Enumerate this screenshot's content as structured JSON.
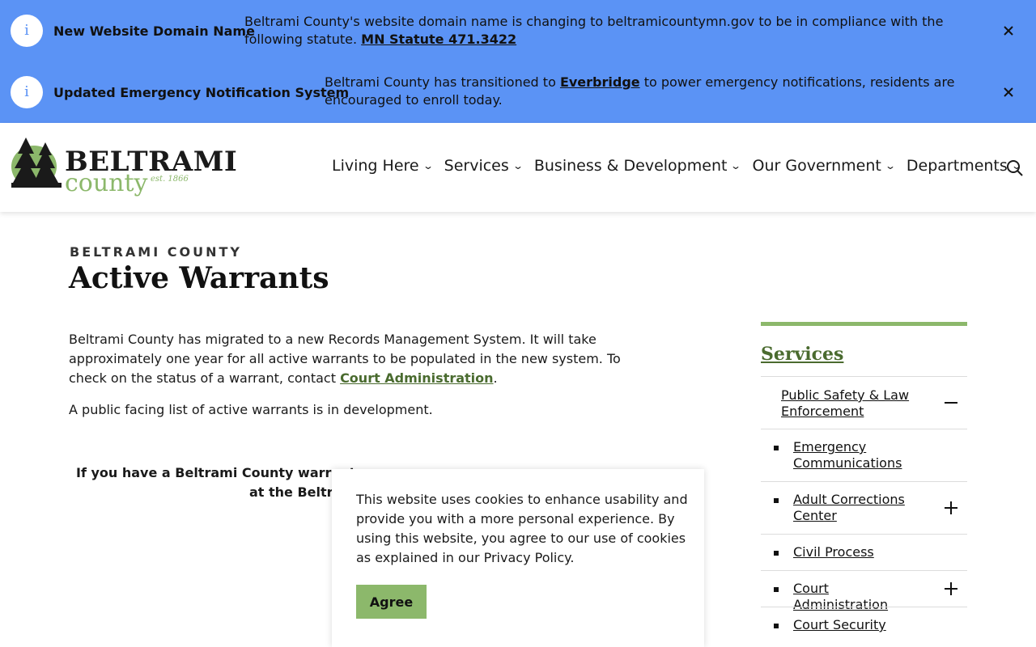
{
  "alerts": [
    {
      "title": "New Website Domain Name",
      "message_before": "Beltrami County's website domain name is changing to beltramicountymn.gov to be in compliance with the following statute. ",
      "link": "MN Statute 471.3422",
      "message_after": ""
    },
    {
      "title": "Updated Emergency Notification System",
      "message_before": "Beltrami County has transitioned to ",
      "link": "Everbridge",
      "message_after": " to power emergency notifications, residents are encouraged to enroll today."
    }
  ],
  "logo": {
    "name": "BELTRAMI",
    "sub": "county",
    "est": "est. 1866"
  },
  "nav": [
    "Living Here",
    "Services",
    "Business & Development",
    "Our Government",
    "Departments"
  ],
  "page": {
    "eyebrow": "BELTRAMI COUNTY",
    "title": "Active Warrants",
    "intro_before": "Beltrami County has migrated to a new Records Management System. It will take approximately one year for all active warrants to be populated in the new system. To check on the status of a warrant, contact ",
    "intro_link": "Court Administration",
    "intro_after": ".",
    "note": "A public facing list of active warrants is in development.",
    "warrant_line1": "If you have a Beltrami County warrant, y",
    "warrant_line2": "at the Beltra"
  },
  "cookie": {
    "text": "This website uses cookies to enhance usability and provide you with a more personal experience. By using this website, you agree to our use of cookies as explained in our Privacy Policy.",
    "button": "Agree"
  },
  "sidebar": {
    "title": "Services",
    "top_item": "Public Safety & Law Enforcement",
    "items": [
      "Emergency Communications",
      "Adult Corrections Center",
      "Civil Process",
      "Court Administration",
      "Court Security"
    ]
  },
  "colors": {
    "alert_bg": "#5b93f5",
    "accent_green": "#8cb86b",
    "link_green": "#4a6b2f"
  }
}
